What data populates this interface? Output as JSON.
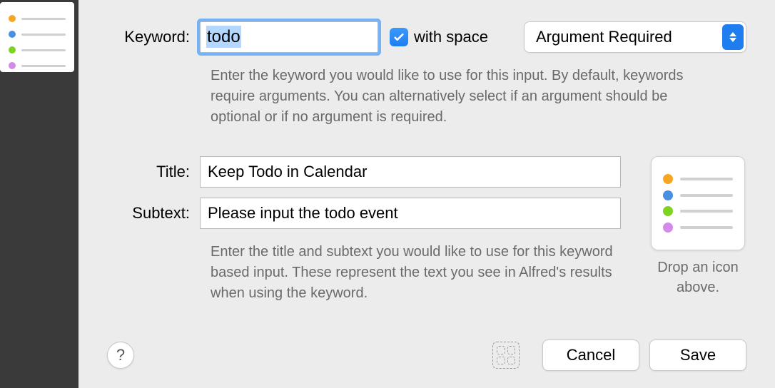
{
  "sidebar": {
    "thumbColors": [
      "#f5a623",
      "#4a90e2",
      "#7ed321",
      "#d48ae8"
    ]
  },
  "form": {
    "keywordLabel": "Keyword:",
    "keywordValue": "todo",
    "withSpaceLabel": "with space",
    "withSpaceChecked": true,
    "argumentSelected": "Argument Required",
    "keywordHelp": "Enter the keyword you would like to use for this input. By default, keywords require arguments. You can alternatively select if an argument should be optional or if no argument is required.",
    "titleLabel": "Title:",
    "titleValue": "Keep Todo in Calendar",
    "subtextLabel": "Subtext:",
    "subtextValue": "Please input the todo event",
    "titleHelp": "Enter the title and subtext you would like to use for this keyword based input. These represent the text you see in Alfred's results when using the keyword.",
    "dropIconText": "Drop an icon above."
  },
  "buttons": {
    "help": "?",
    "cancel": "Cancel",
    "save": "Save"
  },
  "iconColors": [
    "#f5a623",
    "#4a90e2",
    "#7ed321",
    "#d48ae8"
  ]
}
